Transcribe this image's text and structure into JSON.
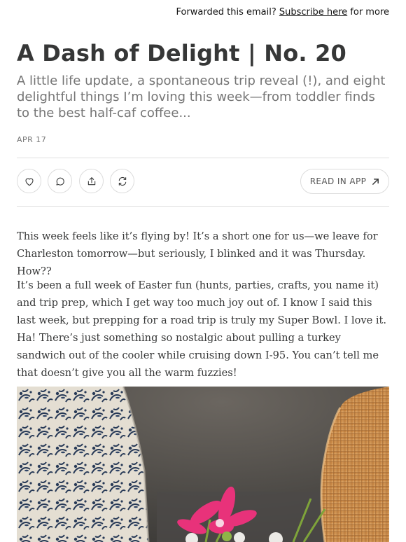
{
  "topbar": {
    "prefix": "Forwarded this email? ",
    "link": "Subscribe here",
    "suffix": " for more"
  },
  "post": {
    "title": "A Dash of Delight | No. 20",
    "subtitle": "A little life update, a spontaneous trip reveal (!), and eight delightful things I’m loving this week—from toddler finds to the best half-caf coffee...",
    "date": "APR 17"
  },
  "actions": {
    "like_icon": "heart-icon",
    "comment_icon": "comment-icon",
    "share_icon": "share-icon",
    "restack_icon": "restack-icon",
    "read_in_app": "READ IN APP",
    "read_in_app_icon": "arrow-up-right-icon"
  },
  "body": {
    "paragraphs": [
      "This week feels like it’s flying by! It’s a short one for us—we leave for Charleston tomorrow—but seriously, I blinked and it was Thursday. How??",
      "It’s been a full week of Easter fun (hunts, parties, crafts, you name it) and trip prep, which I get way too much joy out of. I know I said this last week, but prepping for a road trip is truly my Super Bowl. I love it. Ha! There’s just something so nostalgic about pulling a turkey sandwich out of the cooler while cruising down I-95. You can’t tell me that doesn’t give you all the warm fuzzies!"
    ]
  },
  "colors": {
    "text": "#363737",
    "muted": "#757575",
    "divider": "#e0e0e0"
  }
}
